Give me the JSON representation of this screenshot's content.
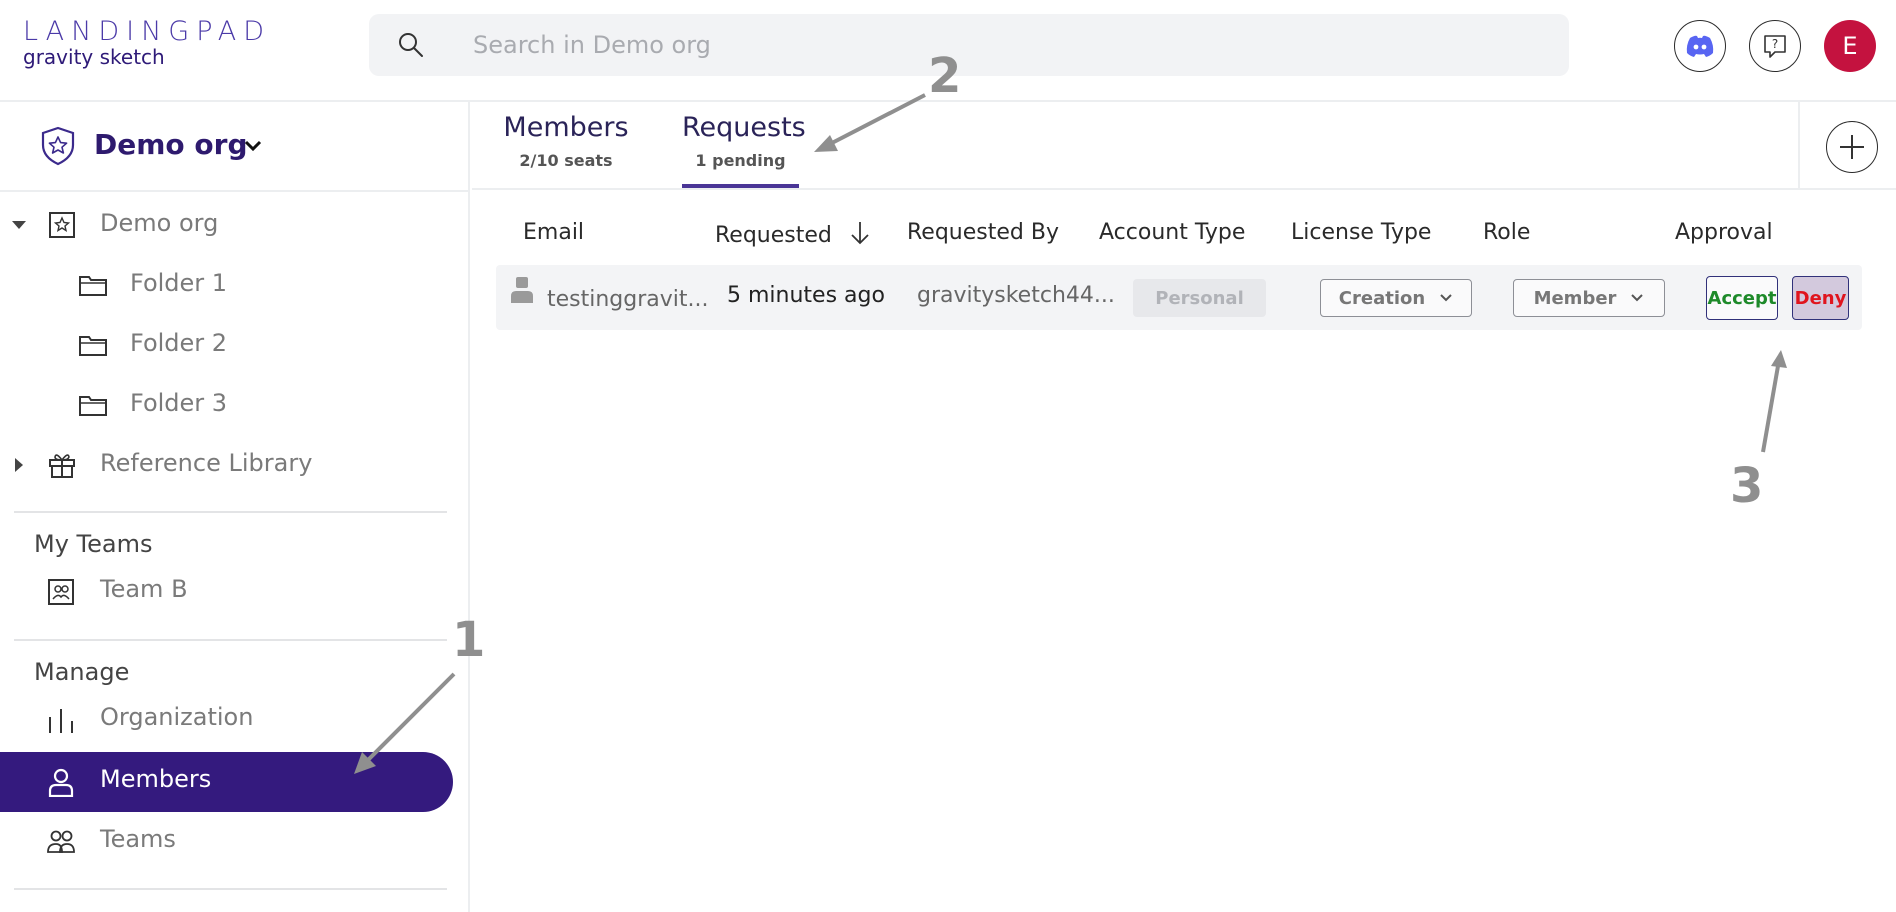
{
  "brand": {
    "top": "LANDINGPAD",
    "bottom": "gravity sketch"
  },
  "search": {
    "placeholder": "Search in Demo org",
    "value": ""
  },
  "header": {
    "avatar_letter": "E"
  },
  "org": {
    "name": "Demo org"
  },
  "tree": {
    "root": "Demo org",
    "folders": [
      "Folder 1",
      "Folder 2",
      "Folder 3"
    ],
    "library": "Reference Library"
  },
  "teams_section": {
    "title": "My Teams",
    "items": [
      "Team B"
    ]
  },
  "manage_section": {
    "title": "Manage",
    "items": [
      "Organization",
      "Members",
      "Teams"
    ],
    "active": "Members"
  },
  "tabs": [
    {
      "label": "Members",
      "sub": "2/10 seats"
    },
    {
      "label": "Requests",
      "sub": "1 pending",
      "active": true
    }
  ],
  "table": {
    "columns": [
      "Email",
      "Requested",
      "Requested By",
      "Account Type",
      "License Type",
      "Role",
      "Approval"
    ],
    "rows": [
      {
        "email": "testinggravit...",
        "requested": "5 minutes ago",
        "requested_by": "gravitysketch44...",
        "account_type": "Personal",
        "license_type": "Creation",
        "role": "Member",
        "accept": "Accept",
        "deny": "Deny"
      }
    ]
  },
  "annotations": [
    "1",
    "2",
    "3"
  ],
  "colors": {
    "primary": "#341a7e",
    "avatar": "#c4123f",
    "accept": "#1e8a2a",
    "deny": "#e0141e",
    "annotation": "#8f8f8f"
  }
}
